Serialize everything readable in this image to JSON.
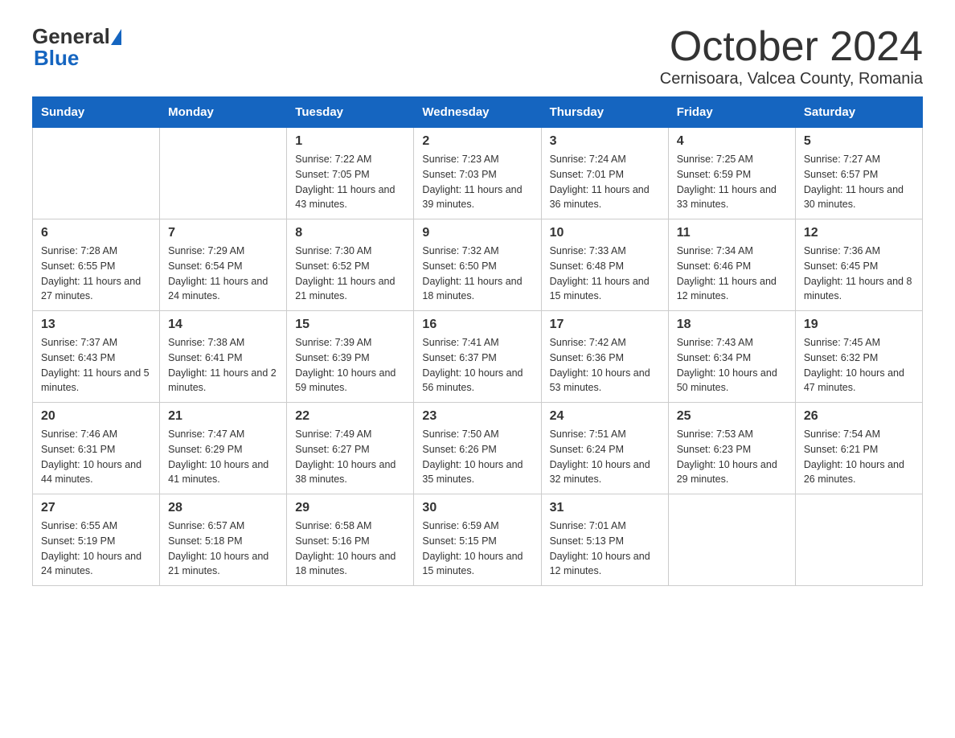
{
  "header": {
    "logo_general": "General",
    "logo_blue": "Blue",
    "month_title": "October 2024",
    "subtitle": "Cernisoara, Valcea County, Romania"
  },
  "days_of_week": [
    "Sunday",
    "Monday",
    "Tuesday",
    "Wednesday",
    "Thursday",
    "Friday",
    "Saturday"
  ],
  "weeks": [
    [
      {
        "day": "",
        "sunrise": "",
        "sunset": "",
        "daylight": ""
      },
      {
        "day": "",
        "sunrise": "",
        "sunset": "",
        "daylight": ""
      },
      {
        "day": "1",
        "sunrise": "Sunrise: 7:22 AM",
        "sunset": "Sunset: 7:05 PM",
        "daylight": "Daylight: 11 hours and 43 minutes."
      },
      {
        "day": "2",
        "sunrise": "Sunrise: 7:23 AM",
        "sunset": "Sunset: 7:03 PM",
        "daylight": "Daylight: 11 hours and 39 minutes."
      },
      {
        "day": "3",
        "sunrise": "Sunrise: 7:24 AM",
        "sunset": "Sunset: 7:01 PM",
        "daylight": "Daylight: 11 hours and 36 minutes."
      },
      {
        "day": "4",
        "sunrise": "Sunrise: 7:25 AM",
        "sunset": "Sunset: 6:59 PM",
        "daylight": "Daylight: 11 hours and 33 minutes."
      },
      {
        "day": "5",
        "sunrise": "Sunrise: 7:27 AM",
        "sunset": "Sunset: 6:57 PM",
        "daylight": "Daylight: 11 hours and 30 minutes."
      }
    ],
    [
      {
        "day": "6",
        "sunrise": "Sunrise: 7:28 AM",
        "sunset": "Sunset: 6:55 PM",
        "daylight": "Daylight: 11 hours and 27 minutes."
      },
      {
        "day": "7",
        "sunrise": "Sunrise: 7:29 AM",
        "sunset": "Sunset: 6:54 PM",
        "daylight": "Daylight: 11 hours and 24 minutes."
      },
      {
        "day": "8",
        "sunrise": "Sunrise: 7:30 AM",
        "sunset": "Sunset: 6:52 PM",
        "daylight": "Daylight: 11 hours and 21 minutes."
      },
      {
        "day": "9",
        "sunrise": "Sunrise: 7:32 AM",
        "sunset": "Sunset: 6:50 PM",
        "daylight": "Daylight: 11 hours and 18 minutes."
      },
      {
        "day": "10",
        "sunrise": "Sunrise: 7:33 AM",
        "sunset": "Sunset: 6:48 PM",
        "daylight": "Daylight: 11 hours and 15 minutes."
      },
      {
        "day": "11",
        "sunrise": "Sunrise: 7:34 AM",
        "sunset": "Sunset: 6:46 PM",
        "daylight": "Daylight: 11 hours and 12 minutes."
      },
      {
        "day": "12",
        "sunrise": "Sunrise: 7:36 AM",
        "sunset": "Sunset: 6:45 PM",
        "daylight": "Daylight: 11 hours and 8 minutes."
      }
    ],
    [
      {
        "day": "13",
        "sunrise": "Sunrise: 7:37 AM",
        "sunset": "Sunset: 6:43 PM",
        "daylight": "Daylight: 11 hours and 5 minutes."
      },
      {
        "day": "14",
        "sunrise": "Sunrise: 7:38 AM",
        "sunset": "Sunset: 6:41 PM",
        "daylight": "Daylight: 11 hours and 2 minutes."
      },
      {
        "day": "15",
        "sunrise": "Sunrise: 7:39 AM",
        "sunset": "Sunset: 6:39 PM",
        "daylight": "Daylight: 10 hours and 59 minutes."
      },
      {
        "day": "16",
        "sunrise": "Sunrise: 7:41 AM",
        "sunset": "Sunset: 6:37 PM",
        "daylight": "Daylight: 10 hours and 56 minutes."
      },
      {
        "day": "17",
        "sunrise": "Sunrise: 7:42 AM",
        "sunset": "Sunset: 6:36 PM",
        "daylight": "Daylight: 10 hours and 53 minutes."
      },
      {
        "day": "18",
        "sunrise": "Sunrise: 7:43 AM",
        "sunset": "Sunset: 6:34 PM",
        "daylight": "Daylight: 10 hours and 50 minutes."
      },
      {
        "day": "19",
        "sunrise": "Sunrise: 7:45 AM",
        "sunset": "Sunset: 6:32 PM",
        "daylight": "Daylight: 10 hours and 47 minutes."
      }
    ],
    [
      {
        "day": "20",
        "sunrise": "Sunrise: 7:46 AM",
        "sunset": "Sunset: 6:31 PM",
        "daylight": "Daylight: 10 hours and 44 minutes."
      },
      {
        "day": "21",
        "sunrise": "Sunrise: 7:47 AM",
        "sunset": "Sunset: 6:29 PM",
        "daylight": "Daylight: 10 hours and 41 minutes."
      },
      {
        "day": "22",
        "sunrise": "Sunrise: 7:49 AM",
        "sunset": "Sunset: 6:27 PM",
        "daylight": "Daylight: 10 hours and 38 minutes."
      },
      {
        "day": "23",
        "sunrise": "Sunrise: 7:50 AM",
        "sunset": "Sunset: 6:26 PM",
        "daylight": "Daylight: 10 hours and 35 minutes."
      },
      {
        "day": "24",
        "sunrise": "Sunrise: 7:51 AM",
        "sunset": "Sunset: 6:24 PM",
        "daylight": "Daylight: 10 hours and 32 minutes."
      },
      {
        "day": "25",
        "sunrise": "Sunrise: 7:53 AM",
        "sunset": "Sunset: 6:23 PM",
        "daylight": "Daylight: 10 hours and 29 minutes."
      },
      {
        "day": "26",
        "sunrise": "Sunrise: 7:54 AM",
        "sunset": "Sunset: 6:21 PM",
        "daylight": "Daylight: 10 hours and 26 minutes."
      }
    ],
    [
      {
        "day": "27",
        "sunrise": "Sunrise: 6:55 AM",
        "sunset": "Sunset: 5:19 PM",
        "daylight": "Daylight: 10 hours and 24 minutes."
      },
      {
        "day": "28",
        "sunrise": "Sunrise: 6:57 AM",
        "sunset": "Sunset: 5:18 PM",
        "daylight": "Daylight: 10 hours and 21 minutes."
      },
      {
        "day": "29",
        "sunrise": "Sunrise: 6:58 AM",
        "sunset": "Sunset: 5:16 PM",
        "daylight": "Daylight: 10 hours and 18 minutes."
      },
      {
        "day": "30",
        "sunrise": "Sunrise: 6:59 AM",
        "sunset": "Sunset: 5:15 PM",
        "daylight": "Daylight: 10 hours and 15 minutes."
      },
      {
        "day": "31",
        "sunrise": "Sunrise: 7:01 AM",
        "sunset": "Sunset: 5:13 PM",
        "daylight": "Daylight: 10 hours and 12 minutes."
      },
      {
        "day": "",
        "sunrise": "",
        "sunset": "",
        "daylight": ""
      },
      {
        "day": "",
        "sunrise": "",
        "sunset": "",
        "daylight": ""
      }
    ]
  ]
}
